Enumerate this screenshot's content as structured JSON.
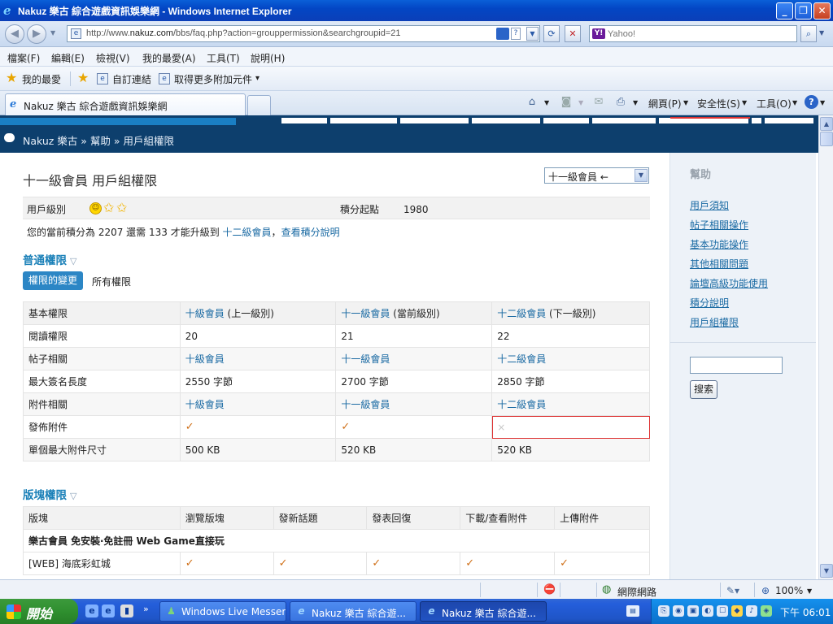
{
  "window": {
    "title": "Nakuz 樂古 綜合遊戲資訊娛樂網 - Windows Internet Explorer",
    "url_prefix": "http://www.",
    "url_domain": "nakuz.com",
    "url_path": "/bbs/faq.php?action=grouppermission&searchgroupid=21",
    "search_placeholder": "Yahoo!",
    "search_logo": "Y!"
  },
  "menu": [
    "檔案(F)",
    "編輯(E)",
    "檢視(V)",
    "我的最愛(A)",
    "工具(T)",
    "說明(H)"
  ],
  "favbar": {
    "favorites": "我的最愛",
    "custom_links": "自訂連結",
    "get_addons": "取得更多附加元件",
    "dropdown": "▾"
  },
  "tabs": {
    "active_label": "Nakuz 樂古 綜合遊戲資訊娛樂網"
  },
  "commandbar": {
    "page": "網頁(P)",
    "safety": "安全性(S)",
    "tools": "工具(O)",
    "help_icon": "?"
  },
  "breadcrumb": "Nakuz 樂古 » 幫助 » 用戶組權限",
  "page": {
    "title": "十一級會員 用戶組權限",
    "group_select": "十一級會員 ←",
    "level_label": "用戶級別",
    "points_label": "積分起點",
    "points_value": "1980",
    "credit_prefix": "您的當前積分為 2207 還需 133 才能升級到",
    "credit_next": "十二級會員",
    "credit_sep": "，",
    "credit_link": "查看積分說明",
    "section_general": "普通權限",
    "section_forum": "版塊權限",
    "tab_changes": "權限的變更",
    "tab_all": "所有權限",
    "tri": "▽"
  },
  "perm_table": {
    "header": {
      "col0": "基本權限",
      "col1_link": "十級會員",
      "col1_note": "(上一級別)",
      "col2_link": "十一級會員",
      "col2_note": "(當前級別)",
      "col3_link": "十二級會員",
      "col3_note": "(下一級別)"
    },
    "rows": [
      {
        "label": "閱讀權限",
        "c1": "20",
        "c2": "21",
        "c3": "22"
      },
      {
        "label": "帖子相關",
        "c1": "十級會員",
        "c2": "十一級會員",
        "c3": "十二級會員"
      },
      {
        "label": "最大簽名長度",
        "c1": "2550 字節",
        "c2": "2700 字節",
        "c3": "2850 字節"
      },
      {
        "label": "附件相關",
        "c1": "十級會員",
        "c2": "十一級會員",
        "c3": "十二級會員"
      },
      {
        "label": "發佈附件",
        "c1": "✓",
        "c2": "✓",
        "c3": "×"
      },
      {
        "label": "單個最大附件尺寸",
        "c1": "500 KB",
        "c2": "520 KB",
        "c3": "520 KB"
      }
    ]
  },
  "forum_table": {
    "headers": [
      "版塊",
      "瀏覽版塊",
      "發新話題",
      "發表回復",
      "下載/查看附件",
      "上傳附件"
    ],
    "category": "樂古會員 免安裝‧免註冊 Web Game直接玩",
    "row": {
      "name": "[WEB] 海底彩虹城",
      "vals": [
        "✓",
        "✓",
        "✓",
        "✓",
        "✓"
      ]
    }
  },
  "sidebar": {
    "title": "幫助",
    "links": [
      "用戶須知",
      "帖子相關操作",
      "基本功能操作",
      "其他相關問題",
      "論壇高級功能使用",
      "積分說明",
      "用戶組權限"
    ],
    "search_button": "搜索"
  },
  "statusbar": {
    "zone": "網際網路",
    "zoom": "100%"
  },
  "taskbar": {
    "start": "開始",
    "tasks": [
      "Windows Live Messen...",
      "Nakuz 樂古 綜合遊...",
      "Nakuz 樂古 綜合遊..."
    ],
    "clock": "下午 06:01",
    "more": "»"
  },
  "colors": {
    "link": "#1a6aa3",
    "section_title": "#1a80b8",
    "site_header": "#0d3f6d",
    "check": "#d0711a",
    "highlight_border": "#dd3333"
  }
}
